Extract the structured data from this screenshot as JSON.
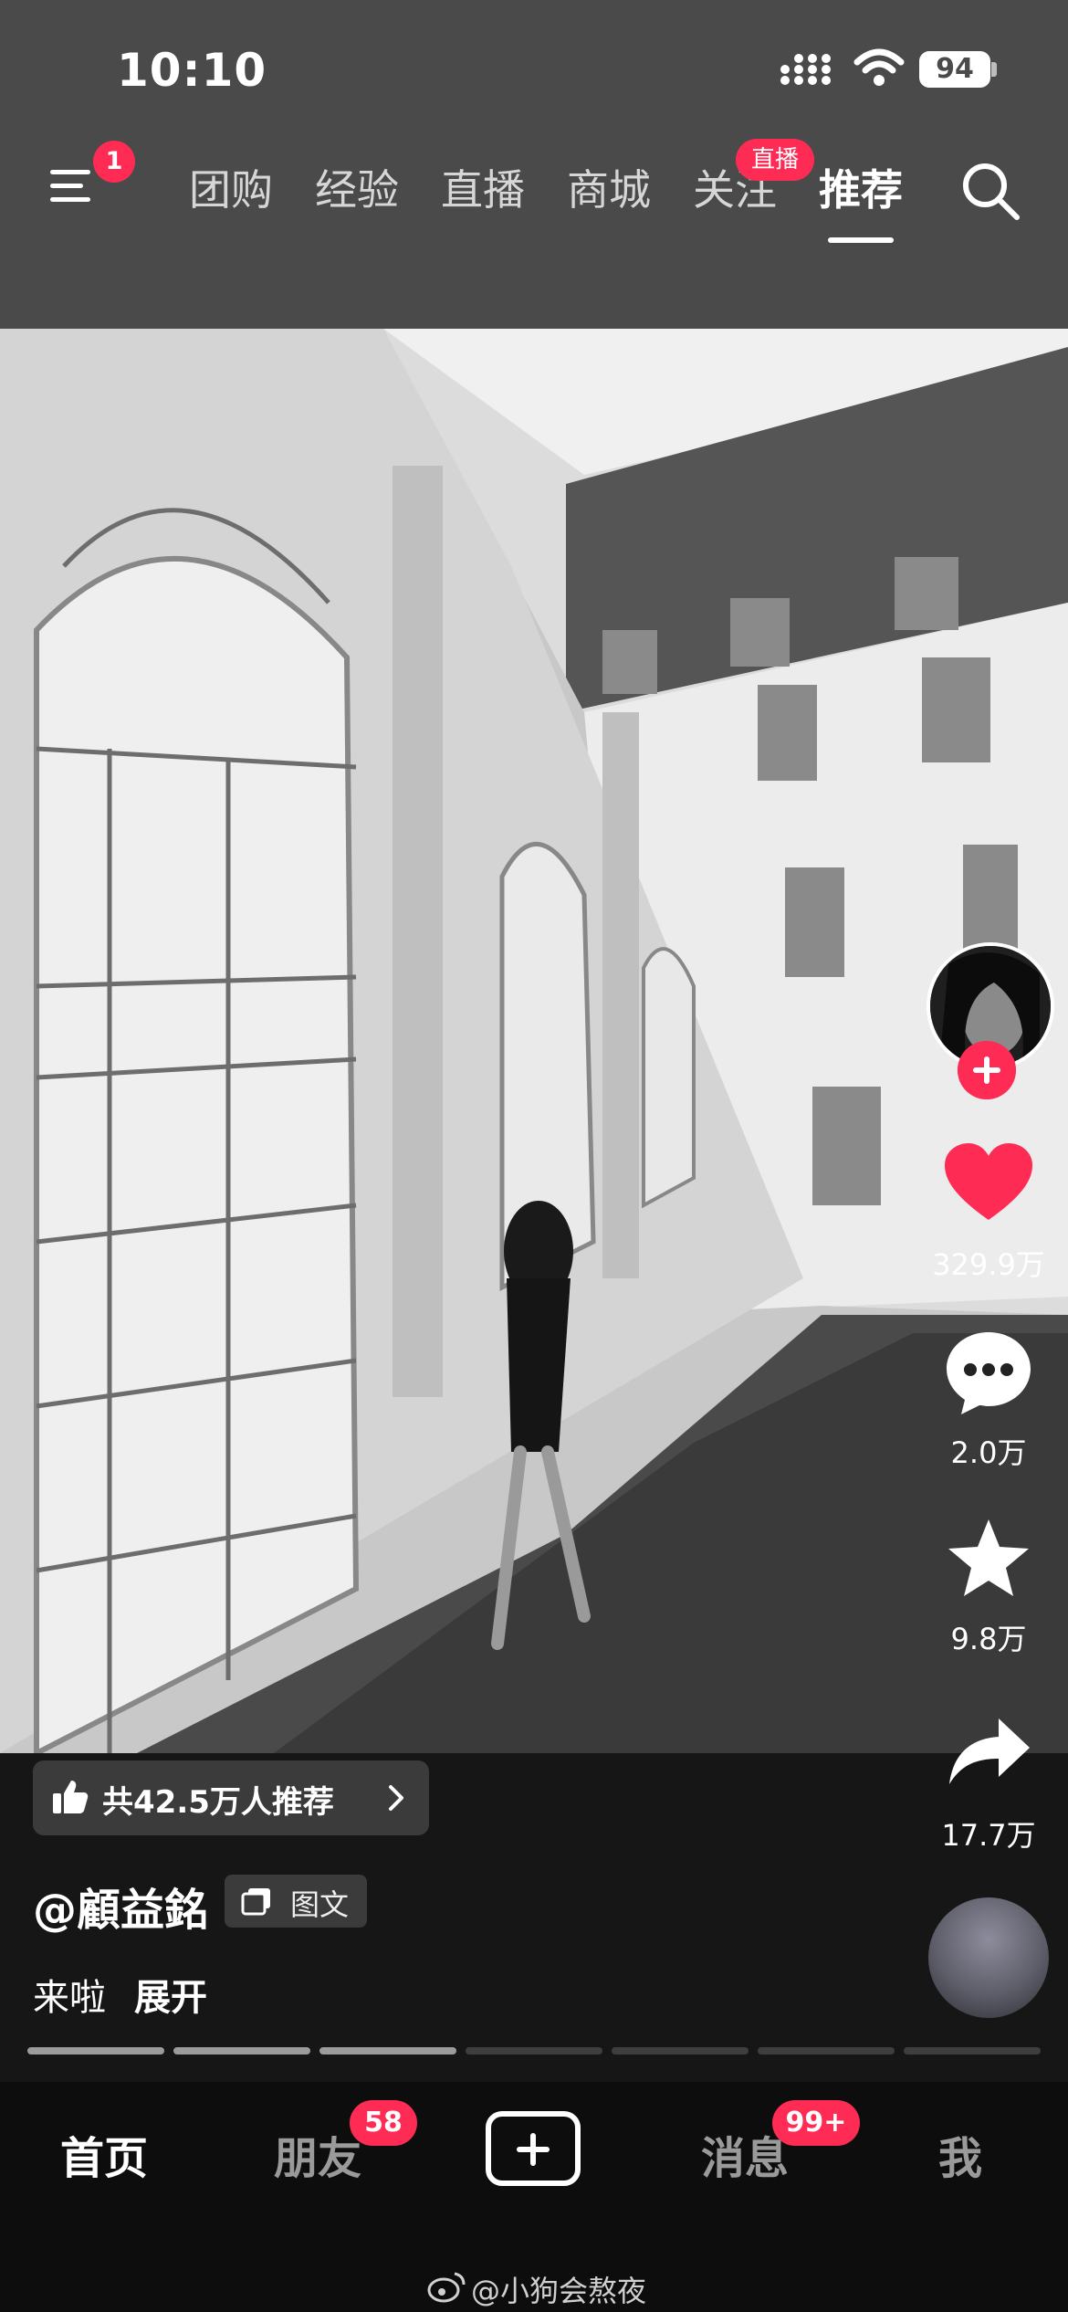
{
  "status_bar": {
    "time": "10:10",
    "battery": "94"
  },
  "top_nav": {
    "menu_badge": "1",
    "tabs": [
      {
        "label": "团购"
      },
      {
        "label": "经验"
      },
      {
        "label": "直播"
      },
      {
        "label": "商城"
      },
      {
        "label": "关注",
        "badge": "直播"
      },
      {
        "label": "推荐",
        "active": true
      }
    ]
  },
  "post": {
    "side_actions": {
      "likes": "329.9万",
      "comments": "2.0万",
      "favorites": "9.8万",
      "shares": "17.7万"
    },
    "recommend_label": "共42.5万人推荐",
    "author": "@顧益銘",
    "content_type": "图文",
    "description": "来啦",
    "expand_label": "展开",
    "progress": {
      "total_slides": 7,
      "current_slide": 3
    }
  },
  "bottom_nav": {
    "home": "首页",
    "friends": "朋友",
    "friends_badge": "58",
    "messages": "消息",
    "messages_badge": "99+",
    "me": "我"
  },
  "watermark": "@小狗会熬夜",
  "colors": {
    "accent": "#fe2c55",
    "header_bg": "#4a4a4a",
    "nav_bg": "#0d0d0d"
  }
}
